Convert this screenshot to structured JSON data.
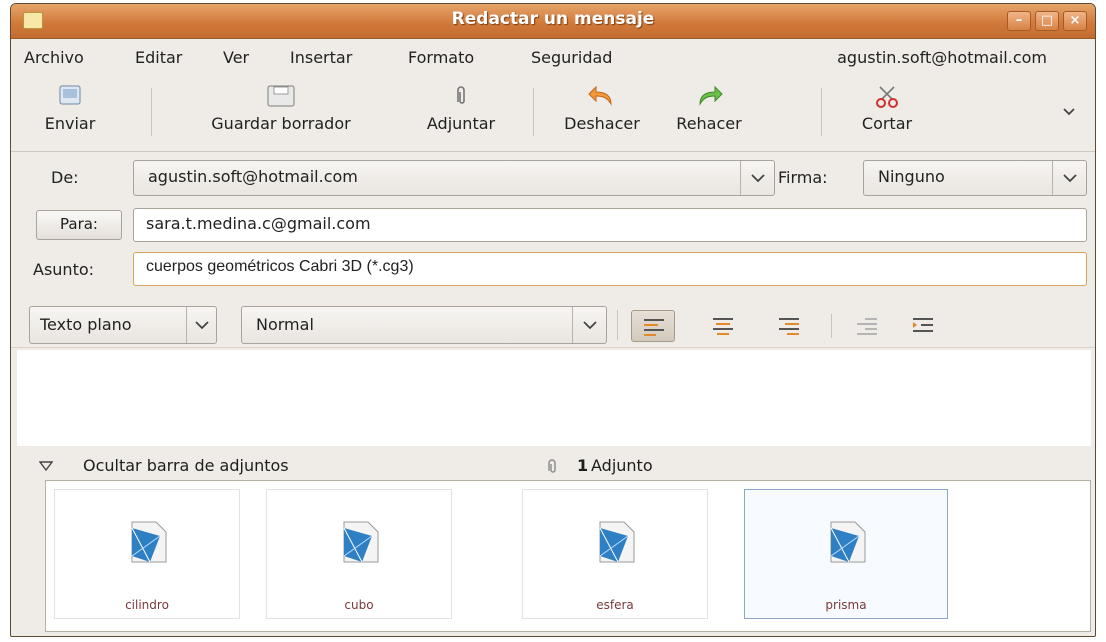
{
  "window": {
    "title": "Redactar un mensaje"
  },
  "menu": {
    "items": [
      "Archivo",
      "Editar",
      "Ver",
      "Insertar",
      "Formato",
      "Seguridad"
    ],
    "account": "agustin.soft@hotmail.com"
  },
  "toolbar": {
    "send": "Enviar",
    "save_draft": "Guardar borrador",
    "attach": "Adjuntar",
    "undo": "Deshacer",
    "redo": "Rehacer",
    "cut": "Cortar"
  },
  "header": {
    "from_label": "De:",
    "from_value": "agustin.soft@hotmail.com",
    "signature_label": "Firma:",
    "signature_value": "Ninguno",
    "to_label": "Para:",
    "to_value": "sara.t.medina.c@gmail.com",
    "subject_label": "Asunto:",
    "subject_value": "cuerpos geométricos Cabri 3D (*.cg3)"
  },
  "format": {
    "mode": "Texto plano",
    "paragraph": "Normal"
  },
  "attachments": {
    "toggle_label": "Ocultar barra de adjuntos",
    "count": "1",
    "count_label": "Adjunto",
    "files": [
      "cilindro",
      "cubo",
      "esfera",
      "prisma"
    ]
  },
  "colors": {
    "titlebar": "#d27a3b",
    "window_bg": "#efebe7",
    "subject_border": "#d9a45e"
  }
}
